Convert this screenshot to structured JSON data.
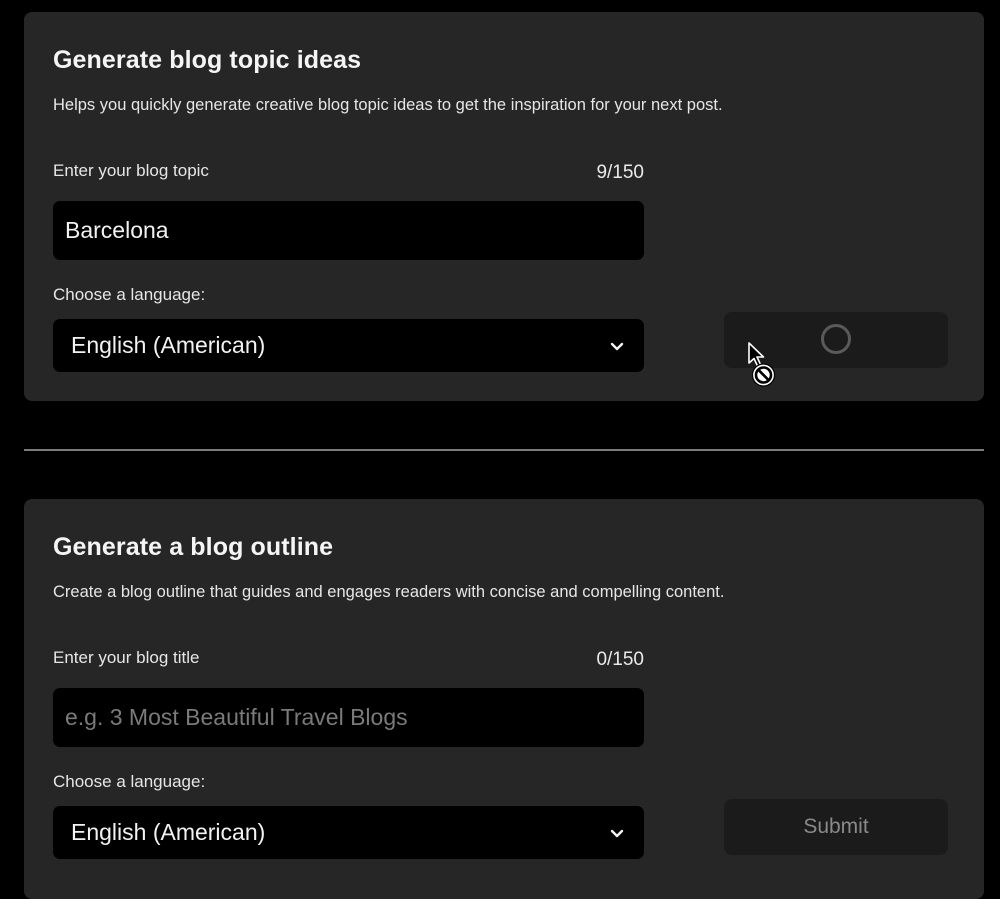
{
  "topics_card": {
    "title": "Generate blog topic ideas",
    "description": "Helps you quickly generate creative blog topic ideas to get the inspiration for your next post.",
    "input_label": "Enter your blog topic",
    "counter": "9/150",
    "input_value": "Barcelona",
    "input_placeholder": "",
    "language_label": "Choose a language:",
    "language_value": "English (American)",
    "button_state": "loading"
  },
  "outline_card": {
    "title": "Generate a blog outline",
    "description": "Create a blog outline that guides and engages readers with concise and compelling content.",
    "input_label": "Enter your blog title",
    "counter": "0/150",
    "input_value": "",
    "input_placeholder": "e.g. 3 Most Beautiful Travel Blogs",
    "language_label": "Choose a language:",
    "language_value": "English (American)",
    "submit_label": "Submit"
  },
  "icons": {
    "dropdown": "chevron-down-icon",
    "spinner": "loading-spinner-icon",
    "cursor": "not-allowed-cursor-icon"
  },
  "colors": {
    "page_background": "#000000",
    "card_background": "#262626",
    "input_background": "#000000",
    "button_background": "#1b1b1b",
    "divider": "#7a7a7a"
  }
}
